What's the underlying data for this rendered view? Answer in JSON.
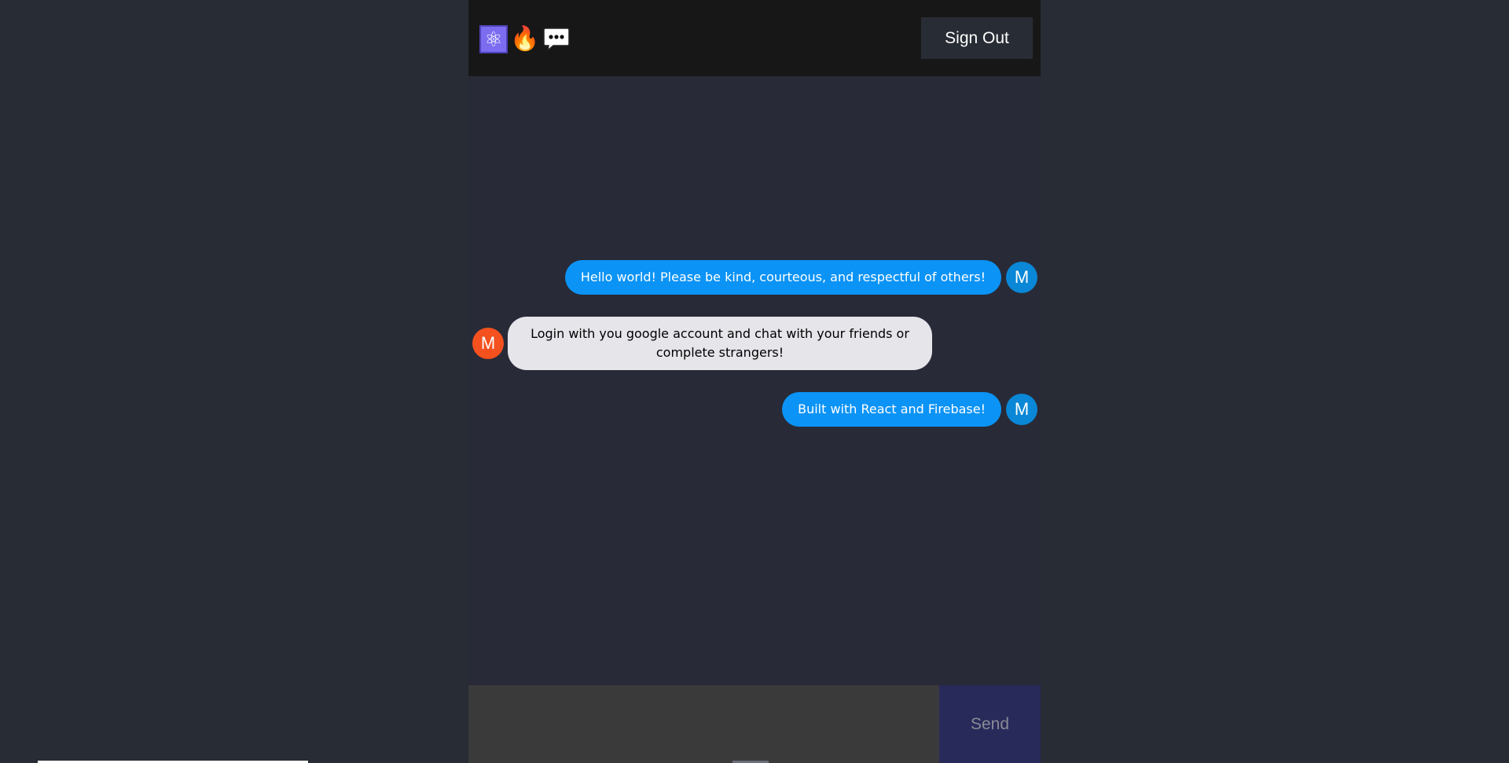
{
  "header": {
    "react_icon": "⚛",
    "fire_icon": "🔥",
    "chat_icon": "speech-bubble-ellipsis",
    "sign_out_label": "Sign Out"
  },
  "messages": [
    {
      "type": "sent",
      "text": "Hello world! Please be kind, courteous, and respectful of others!",
      "avatar": "M",
      "avatar_color": "#0a87d6"
    },
    {
      "type": "received",
      "text": "Login with you google account and chat with your friends or complete strangers!",
      "avatar": "M",
      "avatar_color": "#f4511e"
    },
    {
      "type": "sent",
      "text": "Built with React and Firebase!",
      "avatar": "M",
      "avatar_color": "#0a87d6"
    }
  ],
  "form": {
    "input_value": "",
    "send_label": "Send"
  },
  "colors": {
    "sent_bubble": "#0b93f6",
    "received_bubble": "#e5e5ea",
    "header_bg": "#181717",
    "chat_bg": "#282a37",
    "send_bg": "#282a5a"
  }
}
